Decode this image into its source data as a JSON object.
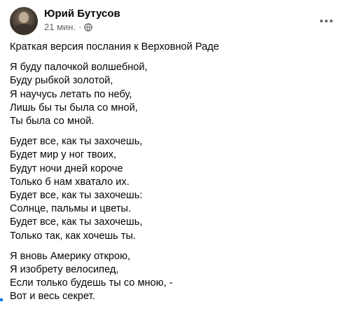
{
  "post": {
    "author": "Юрий Бутусов",
    "time": "21 мин.",
    "separator": "·",
    "privacy_icon": "globe-icon",
    "more_icon": "more-options-icon",
    "title": "Краткая версия послания к Верховной Раде",
    "stanzas": [
      [
        "Я буду палочкой волшебной,",
        "Буду рыбкой золотой,",
        "Я научусь летать по небу,",
        "Лишь бы ты была со мной,",
        "Ты была со мной."
      ],
      [
        "Будет все, как ты захочешь,",
        "Будет мир у ног твоих,",
        "Будут ночи дней короче",
        "Только б нам хватало их.",
        "Будет все, как ты захочешь:",
        "Солнце, пальмы и цветы.",
        "Будет все, как ты захочешь,",
        "Только так, как хочешь ты."
      ],
      [
        "Я вновь Америку открою,",
        "Я изобрету велосипед,",
        "Если только будешь ты со мною, -",
        "Вот и весь секрет."
      ]
    ]
  },
  "colors": {
    "text": "#050505",
    "secondary": "#65676b",
    "accent": "#1877f2"
  }
}
